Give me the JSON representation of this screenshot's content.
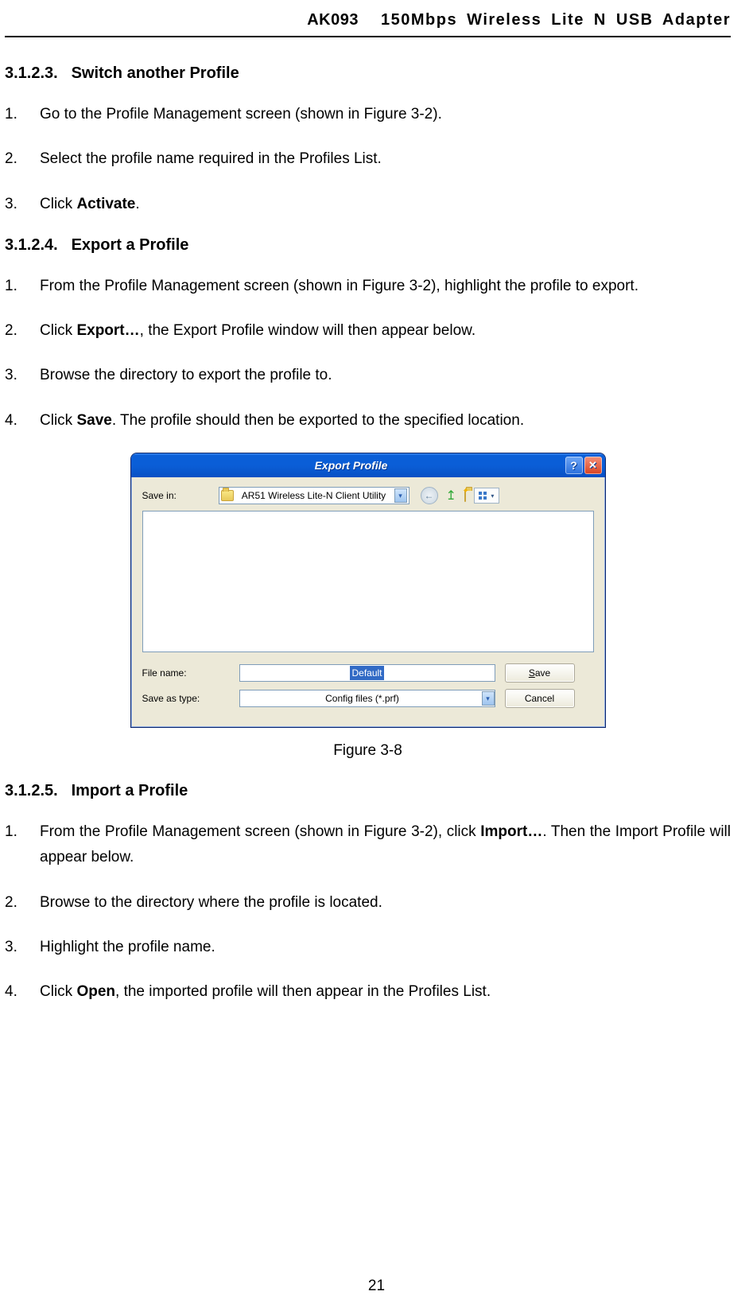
{
  "header": {
    "left": "AK093",
    "right": "150Mbps Wireless Lite N USB Adapter"
  },
  "sections": {
    "s1": {
      "num": "3.1.2.3.",
      "title": "Switch another Profile"
    },
    "s2": {
      "num": "3.1.2.4.",
      "title": "Export a Profile"
    },
    "s3": {
      "num": "3.1.2.5.",
      "title": "Import a Profile"
    }
  },
  "switch_steps": {
    "i1": "Go to the Profile Management screen (shown in Figure 3-2).",
    "i2": "Select the profile name required in the Profiles List.",
    "i3_a": "Click ",
    "i3_b": "Activate",
    "i3_c": "."
  },
  "export_steps": {
    "i1": "From the Profile Management screen (shown in Figure 3-2), highlight the profile to export.",
    "i2_a": "Click ",
    "i2_b": "Export…",
    "i2_c": ", the Export Profile window will then appear below.",
    "i3": "Browse the directory to export the profile to.",
    "i4_a": "Click ",
    "i4_b": "Save",
    "i4_c": ". The profile should then be exported to the specified location."
  },
  "import_steps": {
    "i1_a": "From the Profile Management screen (shown in Figure 3-2), click ",
    "i1_b": "Import…",
    "i1_c": ". Then the Import Profile will appear below.",
    "i2": "Browse to the directory where the profile is located.",
    "i3": "Highlight the profile name.",
    "i4_a": "Click ",
    "i4_b": "Open",
    "i4_c": ", the imported profile will then appear in the Profiles List."
  },
  "dialog": {
    "title": "Export Profile",
    "save_in_label": "Save in:",
    "folder": "AR51 Wireless Lite-N Client Utility",
    "filename_label": "File name:",
    "filename_value": "Default",
    "type_label": "Save as type:",
    "type_value": "Config files (*.prf)",
    "save_btn_pre": "S",
    "save_btn_rest": "ave",
    "cancel_btn": "Cancel",
    "help": "?",
    "close": "✕",
    "dropdown_arrow": "▾",
    "back_arrow": "←",
    "up_arrow": "↥"
  },
  "figure_caption": "Figure 3-8",
  "page_number": "21"
}
